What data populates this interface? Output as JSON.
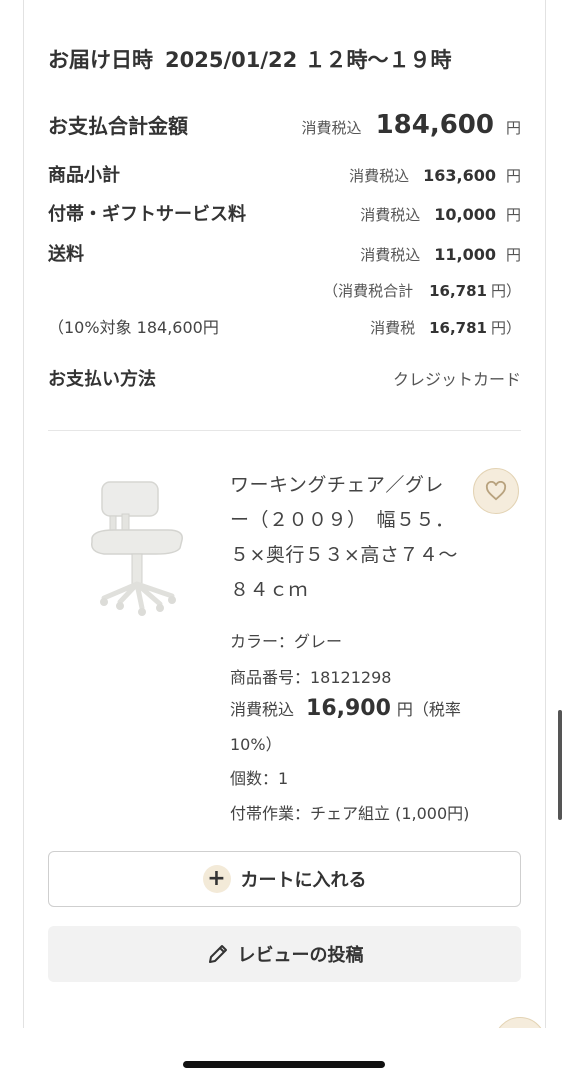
{
  "delivery": {
    "label": "お届け日時",
    "value": "2025/01/22 １２時〜１９時"
  },
  "summary": {
    "total": {
      "label": "お支払合計金額",
      "tax": "消費税込",
      "amount": "184,600",
      "yen": "円"
    },
    "subtotal": {
      "label": "商品小計",
      "tax": "消費税込",
      "amount": "163,600",
      "yen": "円"
    },
    "gift": {
      "label": "付帯・ギフトサービス料",
      "tax": "消費税込",
      "amount": "10,000",
      "yen": "円"
    },
    "shipping": {
      "label": "送料",
      "tax": "消費税込",
      "amount": "11,000",
      "yen": "円"
    },
    "tax_total": {
      "label": "（消費税合計",
      "amount": "16,781",
      "suffix": "円）"
    },
    "tax_rate": {
      "label": "（10%対象 184,600円",
      "tax": "消費税",
      "amount": "16,781",
      "suffix": "円）"
    },
    "payment": {
      "label": "お支払い方法",
      "value": "クレジットカード"
    }
  },
  "product": {
    "name": "ワーキングチェア／グレー（２００９）　幅５５．５×奥行５３×高さ７４〜８４ｃｍ",
    "color": "カラー：グレー",
    "code": "商品番号：18121298",
    "price_tax": "消費税込",
    "price": "16,900",
    "price_suffix": "円（税率",
    "price_rate": "10%）",
    "quantity": "個数：1",
    "option": "付帯作業：チェア組立 (1,000円)",
    "favorite_icon": "heart-icon"
  },
  "buttons": {
    "cart_label": "カートに入れる",
    "cart_icon": "plus-icon",
    "review_label": "レビューの投稿",
    "review_icon": "pencil-icon"
  },
  "colors": {
    "accent_bg": "#f5ecdc",
    "accent_border": "#e3d3b4"
  }
}
